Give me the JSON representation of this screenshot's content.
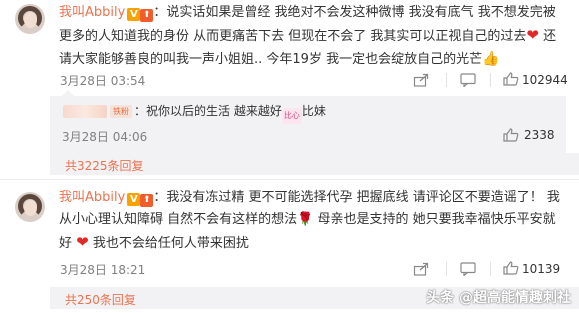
{
  "comment1": {
    "username": "我叫Abbily",
    "badge_v": "V",
    "text_a": "：说实话如果是曾经 我绝对不会发这种微博 我没有底气 我不想发完被更多的人知道我的身份 从而更痛苦下去 但现在不会了 我其实可以正视自己的过去",
    "text_b": " 还请大家能够善良的叫我一声小姐姐.. 今年19岁 我一定也会绽放自己的光芒",
    "emoji_heart": "❤",
    "emoji_thumb": "👍",
    "time": "3月28日 03:54",
    "like_count": "102944"
  },
  "reply": {
    "fan_badge": "铁粉",
    "text_a": "：祝你以后的生活 越来越好",
    "sticker": "比心",
    "text_b": "比妹",
    "time": "3月28日 04:06",
    "like_count": "2338"
  },
  "more1": "共3225条回复",
  "comment2": {
    "username": "我叫Abbily",
    "badge_v": "V",
    "text_a": "：我没有冻过精 更不可能选择代孕 把握底线  请评论区不要造谣了！ 我从小心理认知障碍 自然不会有这样的想法",
    "emoji_rose": "🌹",
    "text_b": " 母亲也是支持的 她只要我幸福快乐平安就好 ",
    "emoji_heart": "❤",
    "text_c": " 我也不会给任何人带来困扰",
    "time": "3月28日 18:21",
    "like_count": "10139"
  },
  "more2": "共250条回复",
  "watermark": "头条 @超高能情趣刺社",
  "icons": {
    "share": "share-icon",
    "comment": "comment-icon",
    "like": "thumb-up-icon"
  }
}
